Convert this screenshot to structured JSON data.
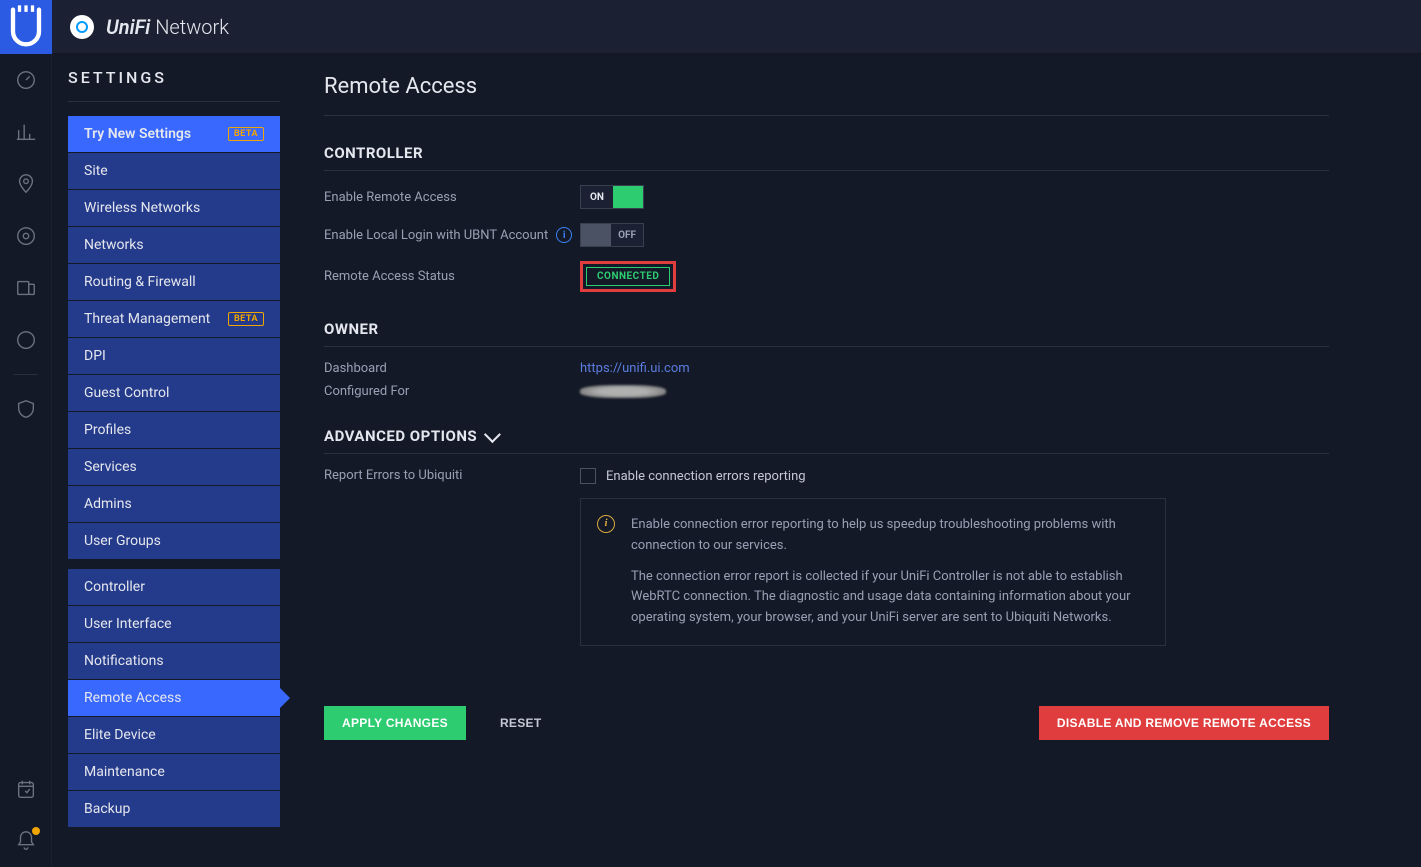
{
  "app": {
    "title_brand": "UniFi",
    "title_suffix": " Network"
  },
  "sidebar": {
    "heading": "SETTINGS",
    "beta_badge": "BETA",
    "group1": [
      {
        "label": "Try New Settings",
        "badge": true,
        "highlight": true
      },
      {
        "label": "Site"
      },
      {
        "label": "Wireless Networks"
      },
      {
        "label": "Networks"
      },
      {
        "label": "Routing & Firewall"
      },
      {
        "label": "Threat Management",
        "badge": true
      },
      {
        "label": "DPI"
      },
      {
        "label": "Guest Control"
      },
      {
        "label": "Profiles"
      },
      {
        "label": "Services"
      },
      {
        "label": "Admins"
      },
      {
        "label": "User Groups"
      }
    ],
    "group2": [
      {
        "label": "Controller"
      },
      {
        "label": "User Interface"
      },
      {
        "label": "Notifications"
      },
      {
        "label": "Remote Access",
        "active": true
      },
      {
        "label": "Elite Device"
      },
      {
        "label": "Maintenance"
      },
      {
        "label": "Backup"
      }
    ]
  },
  "page": {
    "title": "Remote Access",
    "controller": {
      "heading": "CONTROLLER",
      "enable_label": "Enable Remote Access",
      "enable_state": "ON",
      "local_login_label": "Enable Local Login with UBNT Account",
      "local_login_state": "OFF",
      "status_label": "Remote Access Status",
      "status_value": "CONNECTED"
    },
    "owner": {
      "heading": "OWNER",
      "dashboard_label": "Dashboard",
      "dashboard_link": "https://unifi.ui.com",
      "configured_label": "Configured For"
    },
    "advanced": {
      "heading": "ADVANCED OPTIONS",
      "report_label": "Report Errors to Ubiquiti",
      "checkbox_label": "Enable connection errors reporting",
      "info_p1": "Enable connection error reporting to help us speedup troubleshooting problems with connection to our services.",
      "info_p2": "The connection error report is collected if your UniFi Controller is not able to establish WebRTC connection. The diagnostic and usage data containing information about your operating system, your browser, and your UniFi server are sent to Ubiquiti Networks."
    },
    "actions": {
      "apply": "APPLY CHANGES",
      "reset": "RESET",
      "disable": "DISABLE AND REMOVE REMOTE ACCESS"
    }
  }
}
